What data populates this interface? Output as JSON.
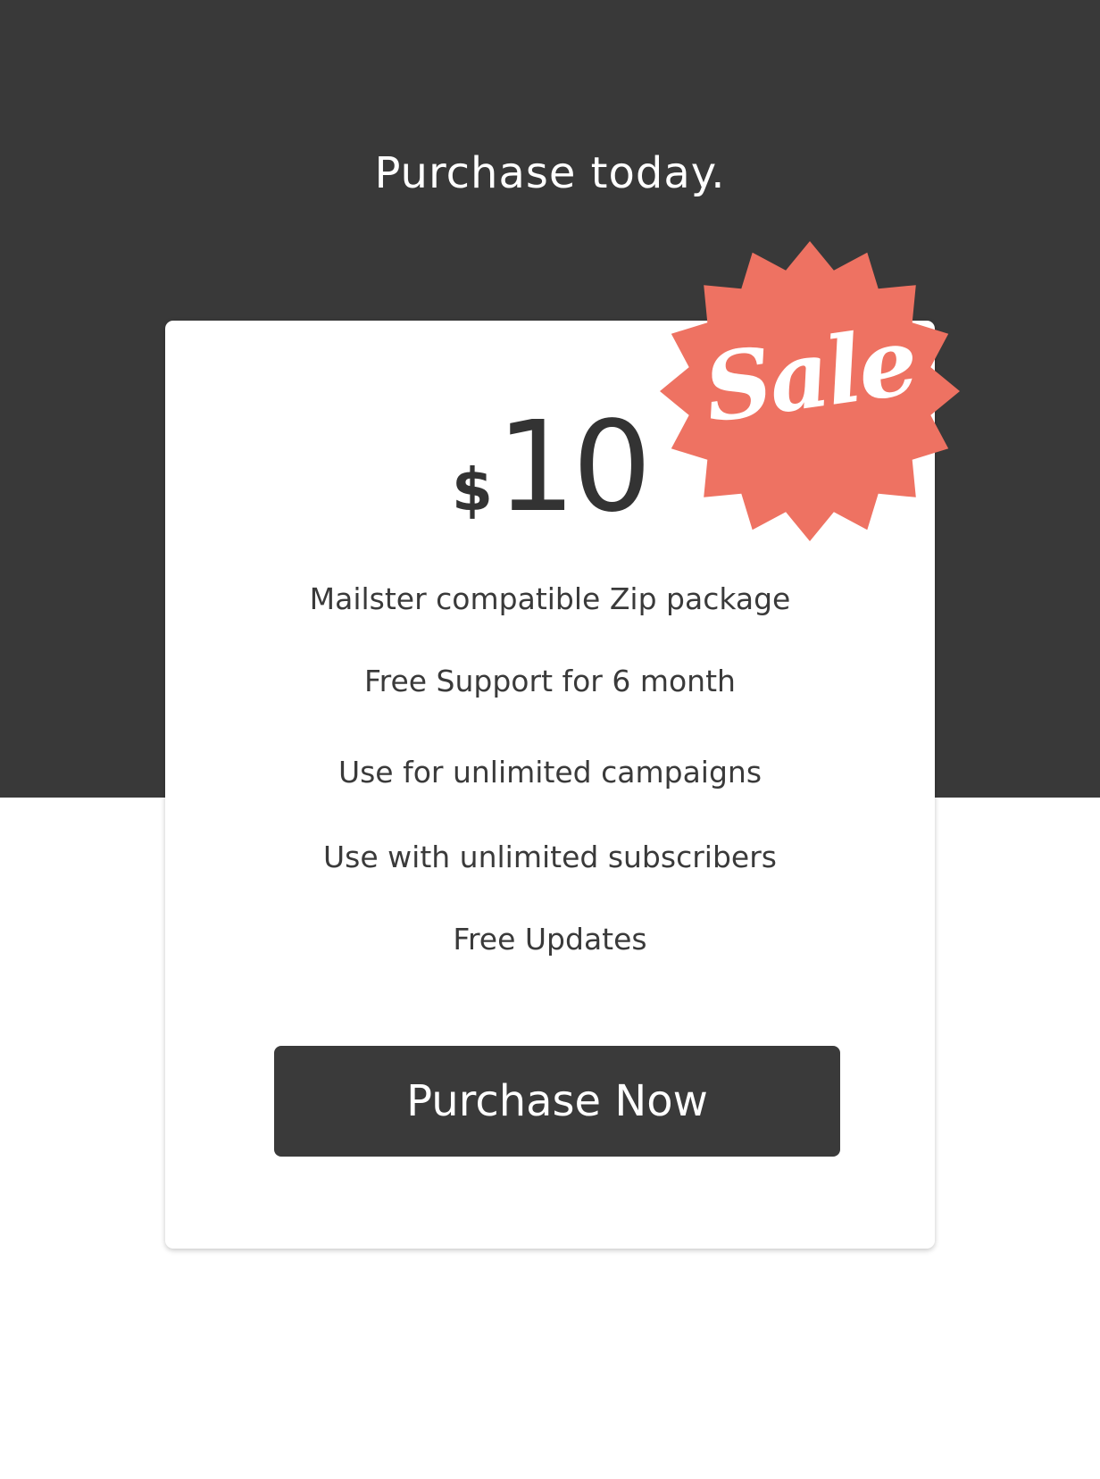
{
  "section": {
    "headline": "Purchase today."
  },
  "pricing": {
    "currency": "$",
    "amount": "10",
    "badge_label": "Sale",
    "features": [
      "Mailster compatible Zip package",
      "Free Support for 6 month",
      "Use for unlimited campaigns",
      "Use with unlimited subscribers",
      "Free Updates"
    ],
    "button_label": "Purchase Now"
  },
  "colors": {
    "dark_band": "#393939",
    "badge": "#EE7262",
    "button": "#3A3A3A",
    "card": "#FFFFFF"
  }
}
